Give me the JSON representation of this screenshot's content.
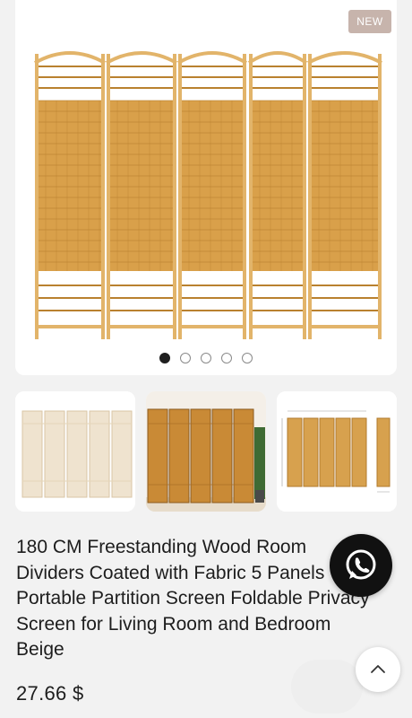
{
  "product": {
    "badge": "NEW",
    "title": "180 CM Freestanding Wood Room Dividers Coated with Fabric 5 Panels Portable Partition Screen Foldable Privacy Screen for Living Room and Bedroom Beige",
    "price": "27.66 $"
  },
  "gallery": {
    "image_count": 5,
    "active_index": 0
  },
  "thumbnails": [
    {
      "name": "beige-room-divider-photo"
    },
    {
      "name": "room-divider-lifestyle-photo"
    },
    {
      "name": "room-divider-dimensions-photo"
    }
  ],
  "actions": {
    "whatsapp_icon": "whatsapp-icon",
    "scroll_top_icon": "chevron-up-icon"
  },
  "colors": {
    "badge_bg": "#c7b4ac",
    "wood": "#d9a04a",
    "wood_dark": "#b9812f",
    "frame": "#e2b46a"
  }
}
